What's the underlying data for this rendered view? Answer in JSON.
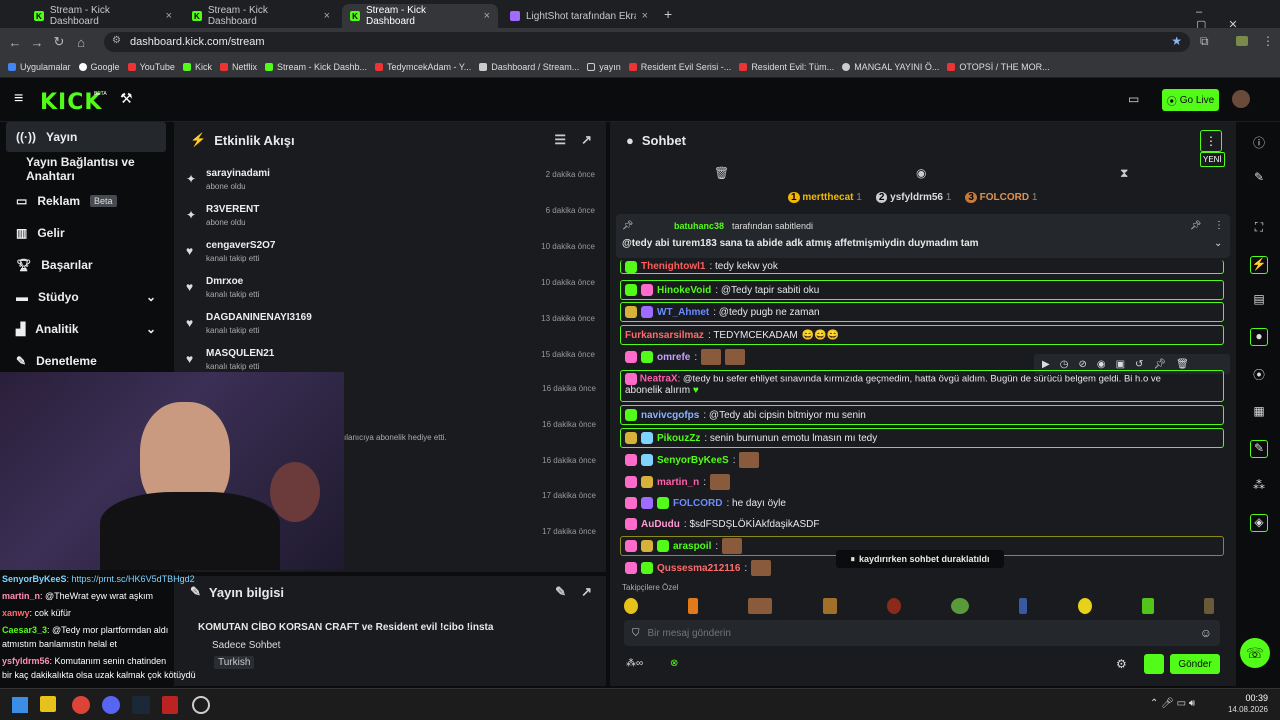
{
  "browser": {
    "tabs": [
      {
        "title": "Stream - Kick Dashboard"
      },
      {
        "title": "Stream - Kick Dashboard"
      },
      {
        "title": "Stream - Kick Dashboard"
      },
      {
        "title": "LightShot tarafından Ekran Gör..."
      }
    ],
    "url": "dashboard.kick.com/stream",
    "bookmarks": [
      "Uygulamalar",
      "Google",
      "YouTube",
      "Kick",
      "Netflix",
      "Stream - Kick Dashb...",
      "TedymcekAdam - Y...",
      "Dashboard / Stream...",
      "yayın",
      "Resident Evil Serisi -...",
      "Resident Evil: Tüm...",
      "MANGAL YAYINI Ö...",
      "OTOPSİ / THE MOR..."
    ]
  },
  "header": {
    "logo": "KICK",
    "logo_tag": "BETA",
    "go_live": "Go Live"
  },
  "sidebar": {
    "items": [
      {
        "label": "Yayın"
      },
      {
        "label": "Yayın Bağlantısı ve Anahtarı"
      },
      {
        "label": "Reklam",
        "badge": "Beta"
      },
      {
        "label": "Gelir"
      },
      {
        "label": "Başarılar"
      },
      {
        "label": "Stüdyo"
      },
      {
        "label": "Analitik"
      },
      {
        "label": "Denetleme"
      }
    ]
  },
  "activity": {
    "title": "Etkinlik Akışı",
    "items": [
      {
        "name": "sarayinadami",
        "sub": "abone oldu",
        "time": "2 dakika önce",
        "icon": "star-icon"
      },
      {
        "name": "R3VERENT",
        "sub": "abone oldu",
        "time": "6 dakika önce",
        "icon": "star-icon"
      },
      {
        "name": "cengaverS2O7",
        "sub": "kanalı takip etti",
        "time": "10 dakika önce",
        "icon": "heart-icon"
      },
      {
        "name": "Dmrxoe",
        "sub": "kanalı takip etti",
        "time": "10 dakika önce",
        "icon": "heart-icon"
      },
      {
        "name": "DAGDANINENAYI3169",
        "sub": "kanalı takip etti",
        "time": "13 dakika önce",
        "icon": "heart-icon"
      },
      {
        "name": "MASQULEN21",
        "sub": "kanalı takip etti",
        "time": "15 dakika önce",
        "icon": "heart-icon"
      }
    ],
    "hidden_times": [
      "16 dakika önce",
      "16 dakika önce",
      "16 dakika önce",
      "17 dakika önce",
      "17 dakika önce"
    ],
    "gift_text": "ılanıcıya abonelik hediye etti."
  },
  "stream_info": {
    "title": "Yayın bilgisi",
    "stream_title": "KOMUTAN CİBO KORSAN CRAFT ve Resident evil !cibo !insta",
    "mode": "Sadece Sohbet",
    "category": "Turkish"
  },
  "overlay_chat": [
    {
      "user": "SenyorByKeeS",
      "text": ": https://prnt.sc/HK6V5dTBHgd2"
    },
    {
      "user": "martin_n",
      "text": ": @TheWrat eyw wrat aşkım"
    },
    {
      "user": "xanwy",
      "text": ": cok küfür"
    },
    {
      "user": "Caesar3_3",
      "text": ": @Tedy mor plartformdan aldı"
    },
    {
      "user": "",
      "text": "atmıstım banlamıstın helal et"
    },
    {
      "user": "ysfyldrm56",
      "text": ": Komutanım senin chatinden"
    },
    {
      "user": "",
      "text": "bir kaç dakikalıkta olsa uzak kalmak çok kötüydü"
    }
  ],
  "chat": {
    "title": "Sohbet",
    "new_label": "YENİ",
    "leaders": [
      {
        "rank": "1",
        "name": "mertthecat",
        "count": "1"
      },
      {
        "rank": "2",
        "name": "ysfyldrm56",
        "count": "1"
      },
      {
        "rank": "3",
        "name": "FOLCORD",
        "count": "1"
      }
    ],
    "pinned_by": "batuhanc38",
    "pinned_suffix": "tarafından sabitlendi",
    "pinned_text": "@tedy abi turem183 sana ta abide adk atmış affetmişmiydin duymadım tam",
    "messages": [
      {
        "user": "Thenightowl1",
        "text": ": tedy kekw yok",
        "color": "#ff5c5c",
        "hl": true
      },
      {
        "user": "HinokeVoid",
        "text": ": @Tedy tapir sabiti oku",
        "color": "#53fc18",
        "hl": true
      },
      {
        "user": "WT_Ahmet",
        "text": ": @tedy pugb ne zaman",
        "color": "#6b8cff",
        "hl": true
      },
      {
        "user": "Furkansarsilmaz",
        "text": ": TEDYMCEKADAM",
        "color": "#ff6b6b",
        "hl": true
      },
      {
        "user": "omrefe",
        "text": ":",
        "color": "#c6a0ff",
        "hl": false
      },
      {
        "user": "NeatraX",
        "text": ": @tedy bu sefer ehliyet sınavında kırmızıda geçmedim, hatta övgü aldım. Bugün de sürücü belgem geldi. Bi h.o ve",
        "color": "#ff5fa8",
        "hl": true
      },
      {
        "user": "",
        "text": "abonelik alırım",
        "color": "#fff",
        "hl": false
      },
      {
        "user": "navivcgofps",
        "text": ": @Tedy abi cipsin bitmiyor mu senin",
        "color": "#8ab4ff",
        "hl": true
      },
      {
        "user": "PikouzZz",
        "text": ": senin burnunun emotu lmasın mı tedy",
        "color": "#53fc18",
        "hl": true
      },
      {
        "user": "SenyorByKeeS",
        "text": ":",
        "color": "#53fc18",
        "hl": false
      },
      {
        "user": "martin_n",
        "text": ":",
        "color": "#ff5fa8",
        "hl": false
      },
      {
        "user": "FOLCORD",
        "text": ": he dayı öyle",
        "color": "#6b8cff",
        "hl": false
      },
      {
        "user": "AuDudu",
        "text": ": $sdFSDŞLÖKİAkfdaşikASDF",
        "color": "#ff9ad5",
        "hl": false
      },
      {
        "user": "araspoil",
        "text": ":",
        "color": "#53fc18",
        "hl": true
      },
      {
        "user": "Qussesma212116",
        "text": ":",
        "color": "#ff6b6b",
        "hl": false
      }
    ],
    "paused": "kaydırırken sohbet duraklatıldı",
    "followers_label": "Takipçilere Özel",
    "input_placeholder": "Bir mesaj gönderin",
    "send": "Gönder"
  },
  "taskbar": {
    "time": "00:39",
    "date": "14.08.2026"
  }
}
